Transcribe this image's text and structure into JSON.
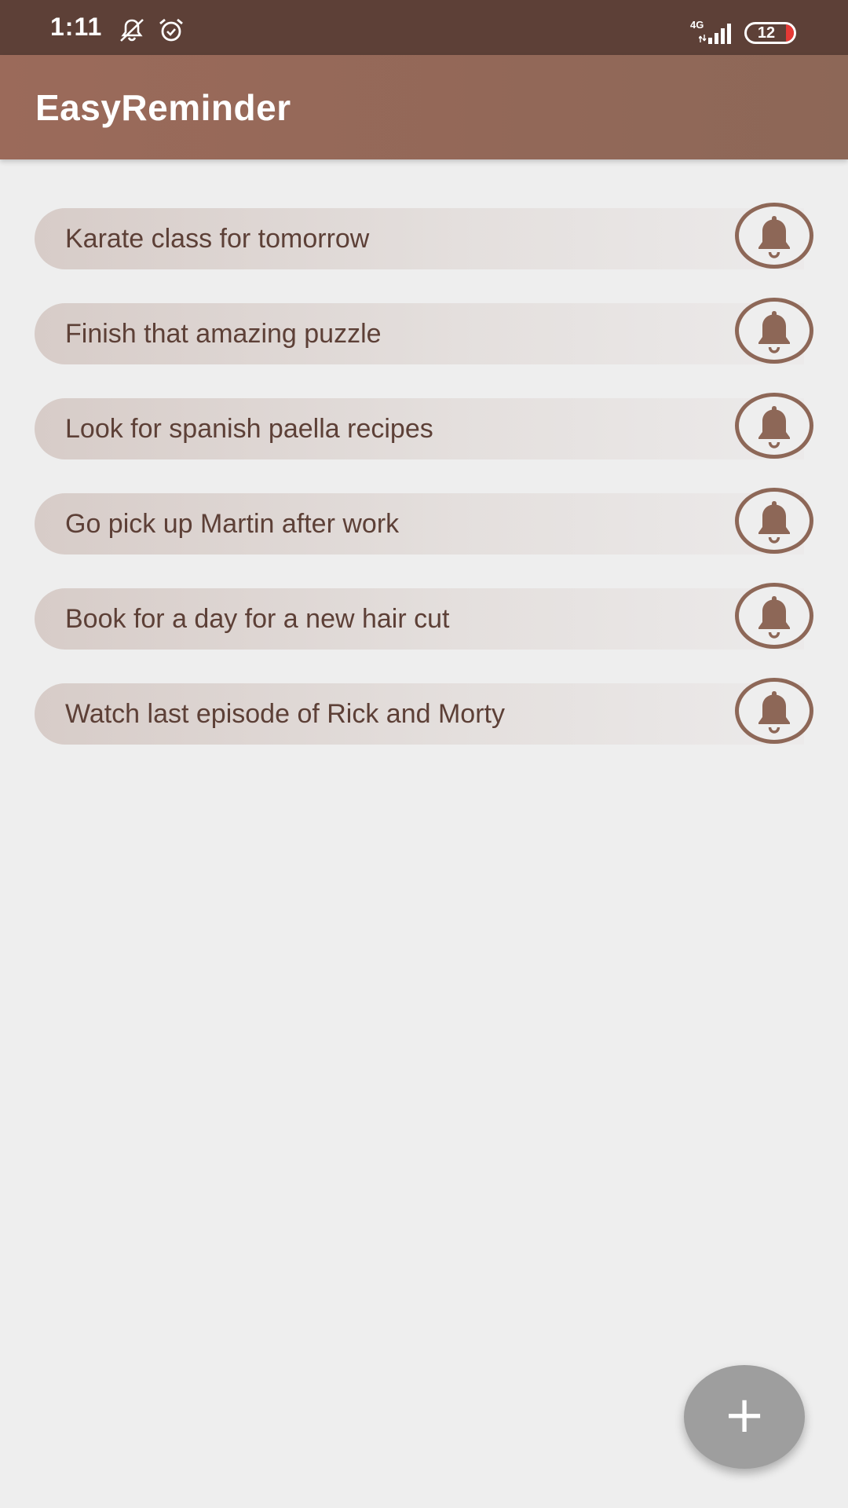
{
  "status_bar": {
    "time": "1:11",
    "network_type": "4G",
    "battery_level": "12",
    "icons": [
      "notifications-off-icon",
      "alarm-icon",
      "signal-icon",
      "battery-icon"
    ]
  },
  "app_bar": {
    "title": "EasyReminder"
  },
  "reminders": [
    {
      "text": "Karate class for tomorrow",
      "icon": "bell-icon"
    },
    {
      "text": "Finish that amazing puzzle",
      "icon": "bell-icon"
    },
    {
      "text": "Look for spanish paella recipes",
      "icon": "bell-icon"
    },
    {
      "text": "Go pick up Martin after work",
      "icon": "bell-icon"
    },
    {
      "text": "Book for a day for a new hair cut",
      "icon": "bell-icon"
    },
    {
      "text": "Watch last episode of Rick and Morty",
      "icon": "bell-icon"
    }
  ],
  "fab": {
    "icon": "plus-icon",
    "symbol": "+"
  },
  "colors": {
    "primary_dark": "#5d4037",
    "primary": "#8d6757",
    "accent_text": "#5d4037",
    "fab": "#9e9e9e",
    "background": "#eeeeee"
  }
}
